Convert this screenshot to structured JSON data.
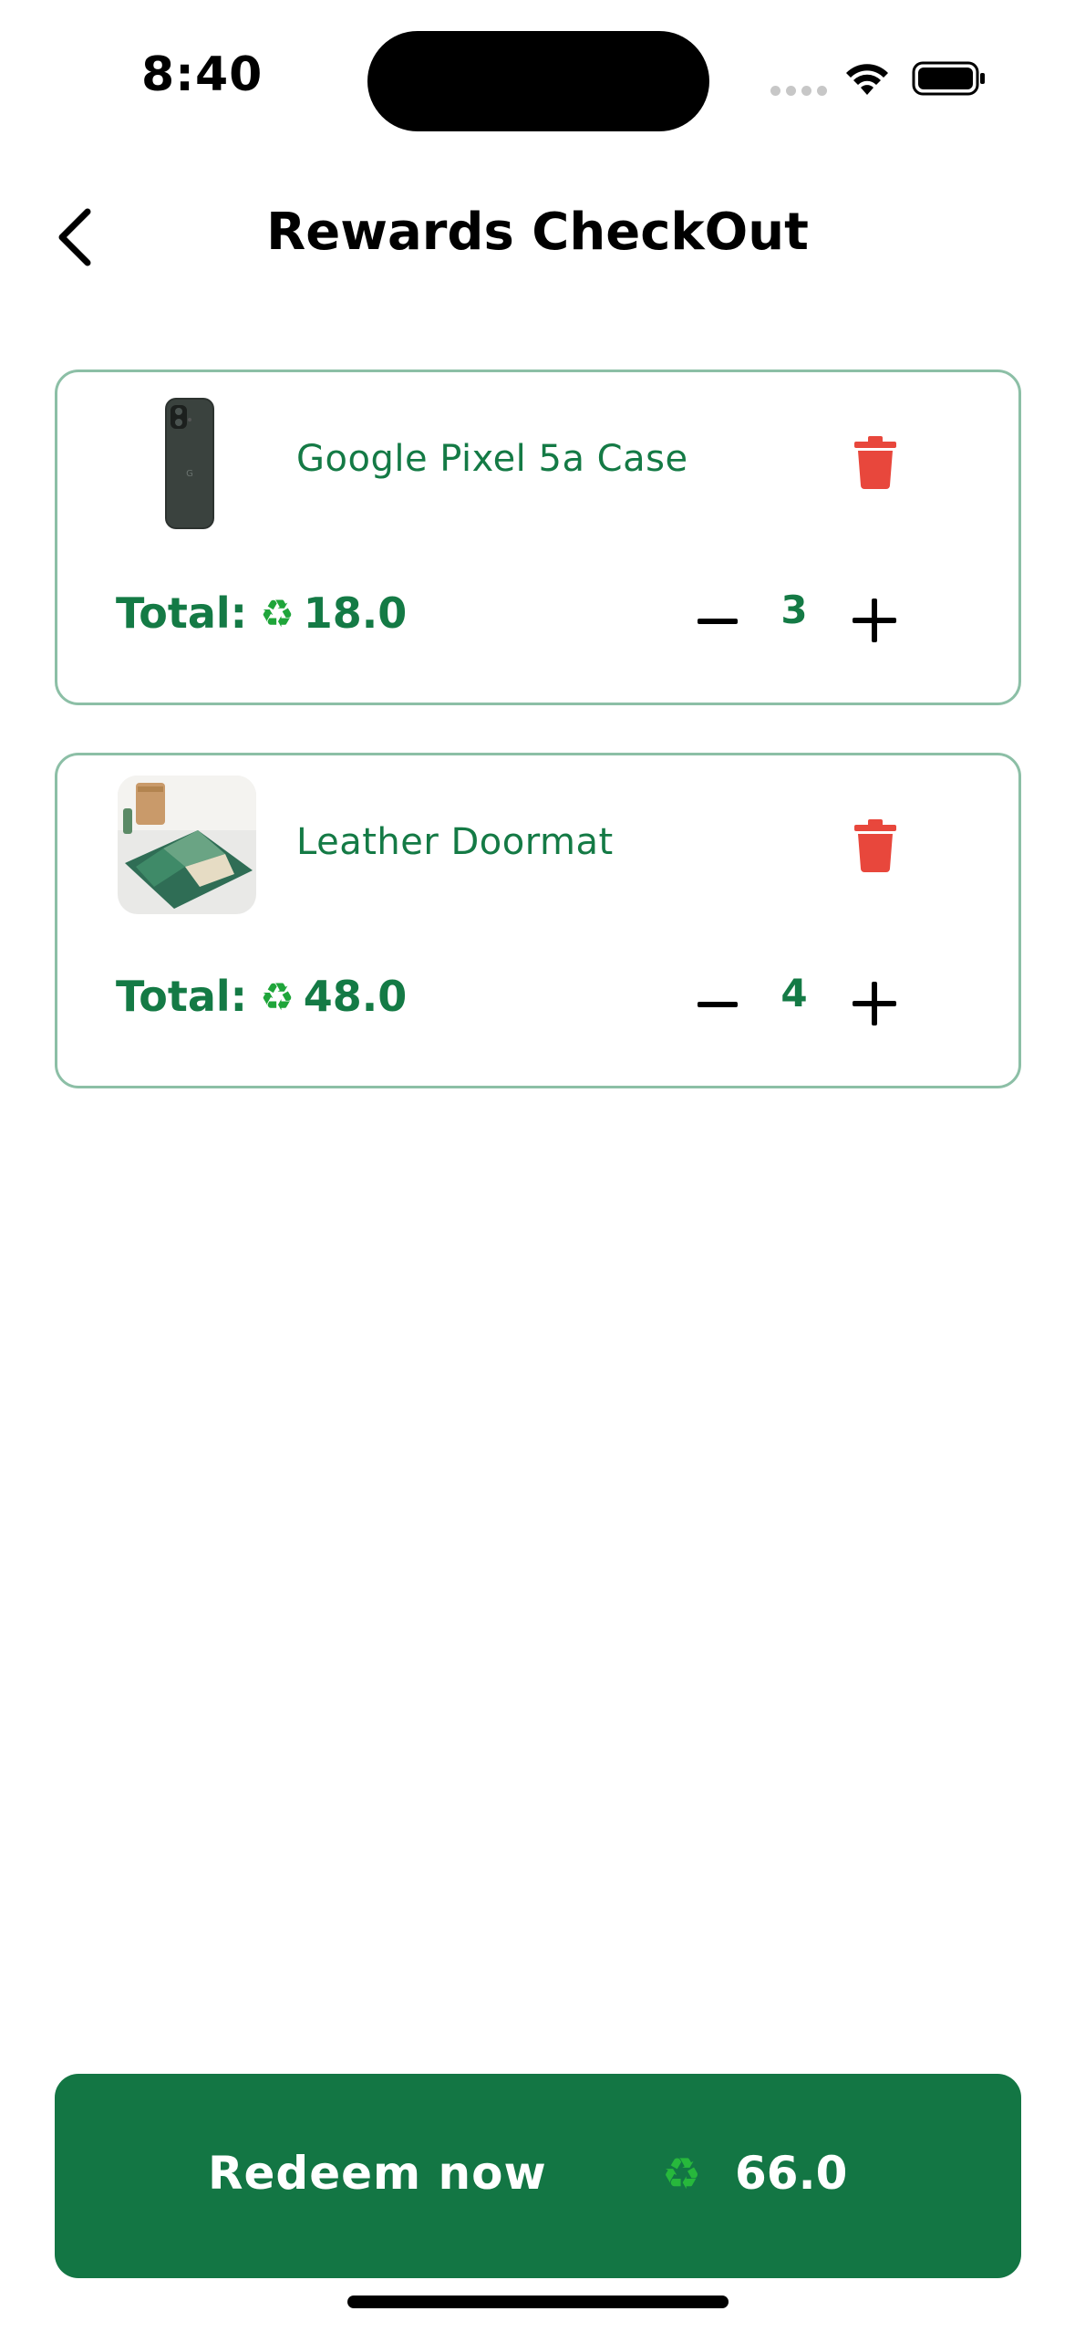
{
  "status_bar": {
    "time": "8:40"
  },
  "header": {
    "title": "Rewards CheckOut",
    "back_icon": "chevron-left-icon"
  },
  "cart": {
    "items": [
      {
        "name": "Google Pixel 5a  Case",
        "total_label": "Total:",
        "total_value": "18.0",
        "quantity": "3",
        "image": "phone-case-image"
      },
      {
        "name": "Leather Doormat",
        "total_label": "Total:",
        "total_value": "48.0",
        "quantity": "4",
        "image": "doormat-image"
      }
    ],
    "currency_icon": "♻"
  },
  "footer": {
    "redeem_label": "Redeem now",
    "grand_total": "66.0"
  },
  "colors": {
    "accent_green": "#137644",
    "text_green": "#147a45",
    "card_border": "#8cbfa6",
    "delete_red": "#e8473c"
  }
}
